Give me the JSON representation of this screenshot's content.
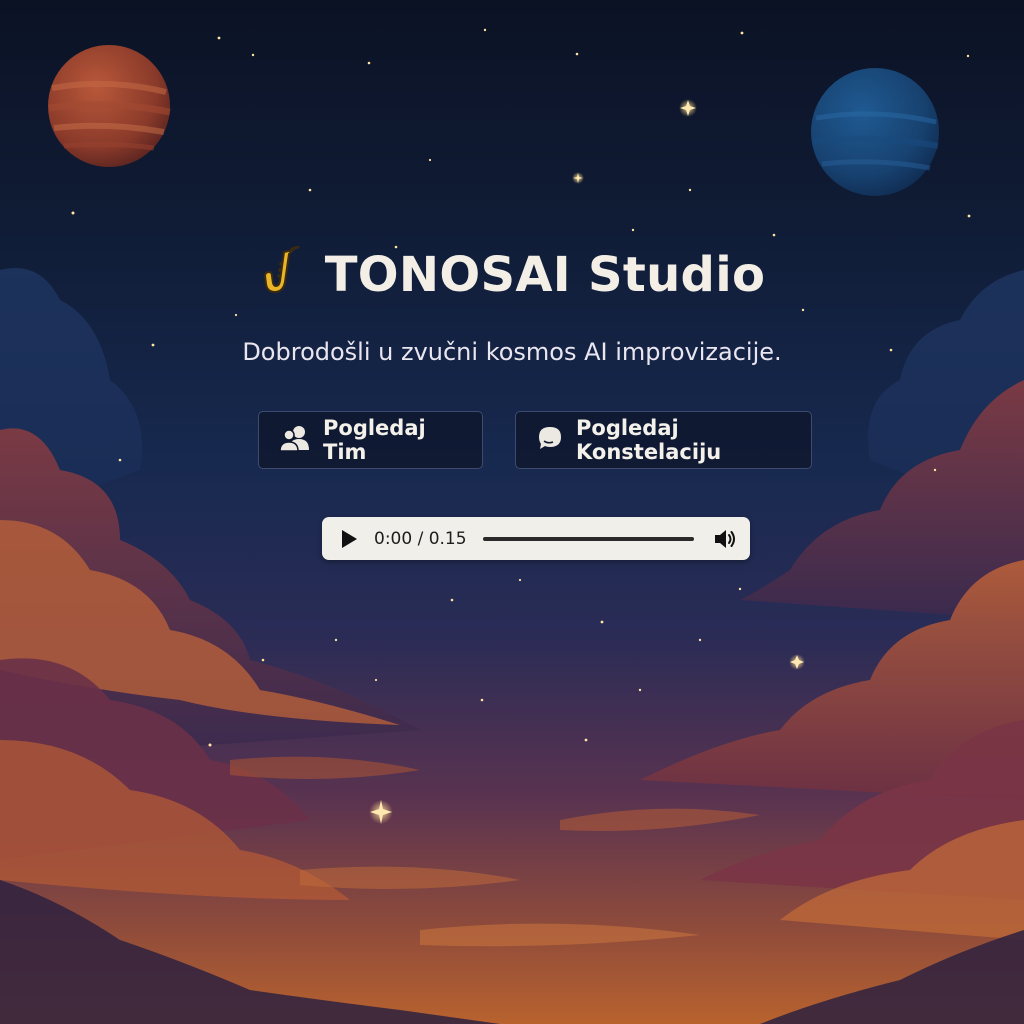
{
  "app": {
    "title": "TONOSAI Studio",
    "title_icon": "saxophone-icon",
    "subtitle": "Dobrodošli u zvučni kosmos AI improvizacije."
  },
  "actions": {
    "team_label": "Pogledaj Tim",
    "team_icon": "users-icon",
    "constellation_label": "Pogledaj Konstelaciju",
    "constellation_icon": "chat-bubble-icon"
  },
  "player": {
    "time": "0:00 / 0.15",
    "progress": 0,
    "play_icon": "play-icon",
    "volume_icon": "volume-icon"
  },
  "colors": {
    "sky_top": "#0b1224",
    "sky_mid": "#17294f",
    "horizon": "#b8622e",
    "title_text": "#f4efe6",
    "button_bg": "#0e162c",
    "player_bg": "#f1efe9"
  }
}
